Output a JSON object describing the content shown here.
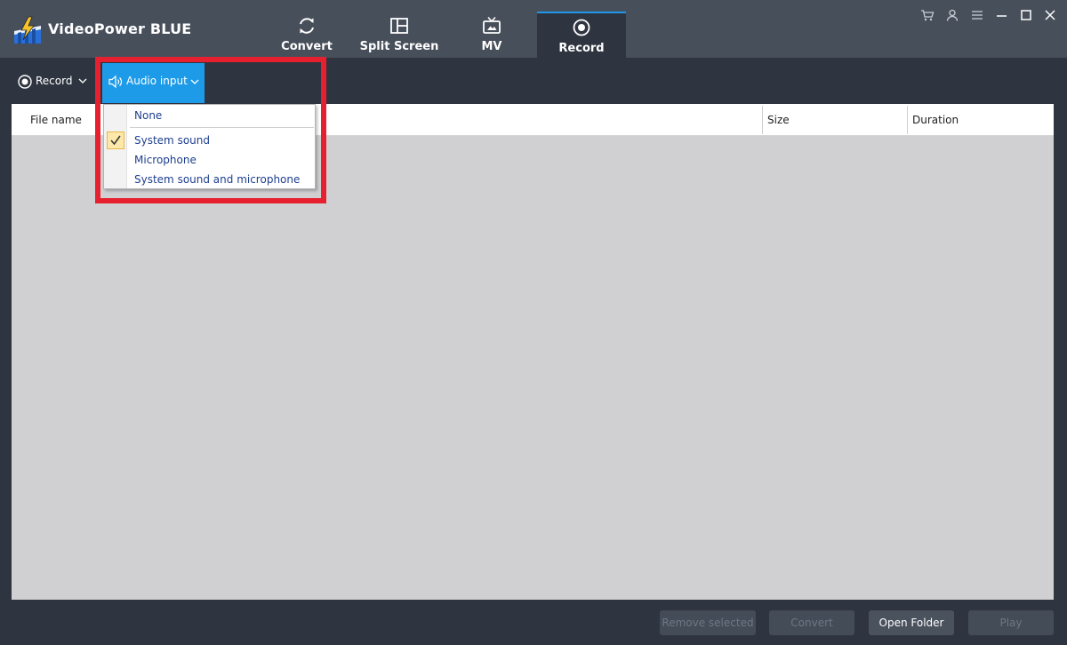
{
  "app": {
    "title": "VideoPower BLUE"
  },
  "tabs": [
    {
      "label": "Convert",
      "icon": "refresh-icon"
    },
    {
      "label": "Split Screen",
      "icon": "split-screen-icon"
    },
    {
      "label": "MV",
      "icon": "tv-icon"
    },
    {
      "label": "Record",
      "icon": "record-icon",
      "active": true
    }
  ],
  "window_controls": [
    "cart-icon",
    "user-icon",
    "menu-list-icon",
    "minimize-icon",
    "maximize-icon",
    "close-icon"
  ],
  "toolbar": {
    "record_label": "Record",
    "audio_input_label": "Audio input"
  },
  "table": {
    "columns": [
      "File name",
      "Size",
      "Duration"
    ]
  },
  "audio_menu": {
    "items": [
      {
        "label": "None",
        "checked": false
      },
      {
        "label": "System sound",
        "checked": true
      },
      {
        "label": "Microphone",
        "checked": false
      },
      {
        "label": "System sound and microphone",
        "checked": false
      }
    ]
  },
  "footer": {
    "remove_selected": "Remove selected",
    "convert": "Convert",
    "open_folder": "Open Folder",
    "play": "Play"
  },
  "colors": {
    "titlebar": "#474f5b",
    "background": "#2f3540",
    "accent": "#1e9be8",
    "highlight": "#e6202e"
  }
}
